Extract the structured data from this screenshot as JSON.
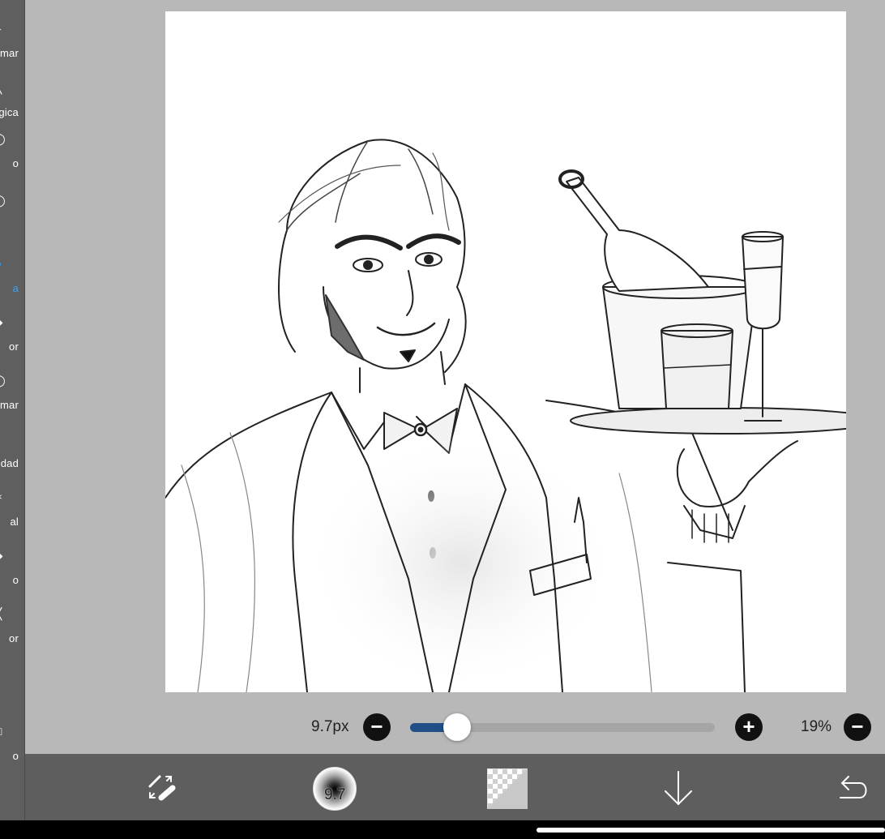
{
  "sidebar": {
    "items": [
      {
        "label": "mar",
        "icon": "transform-icon",
        "glyph": "▸"
      },
      {
        "label": "gica",
        "icon": "magic-wand-icon",
        "glyph": "╲"
      },
      {
        "label": "o",
        "icon": "lasso-icon",
        "glyph": "◯"
      },
      {
        "label": "",
        "icon": "filter-icon",
        "glyph": "◯"
      },
      {
        "label": "a",
        "icon": "brush-icon",
        "glyph": "●",
        "active": true
      },
      {
        "label": "or",
        "icon": "eraser-icon",
        "glyph": "◆"
      },
      {
        "label": "mar",
        "icon": "smudge-icon",
        "glyph": "◯"
      },
      {
        "label": "dad",
        "icon": "blur-icon",
        "glyph": ""
      },
      {
        "label": "al",
        "icon": "bucket-icon",
        "glyph": "✶"
      },
      {
        "label": "o",
        "icon": "text-icon",
        "glyph": "◆"
      },
      {
        "label": "or",
        "icon": "divider-icon",
        "glyph": "╳"
      },
      {
        "label": "o",
        "icon": "frame-icon",
        "glyph": "□"
      }
    ],
    "accent_color": "#2ea7ff"
  },
  "brush_bar": {
    "size_label": "9.7px",
    "size_slider_fraction": 0.155,
    "minus_glyph": "−",
    "plus_glyph": "+",
    "zoom_label": "19%",
    "zoom_minus_glyph": "−",
    "slider_fill_color": "#1f4f86"
  },
  "toolbar": {
    "swap_icon": "swap-tools-icon",
    "brush_size_value": "9.7",
    "color_icon": "color-swatch-icon",
    "layer_down_glyph": "↓",
    "undo_glyph": "↶"
  }
}
